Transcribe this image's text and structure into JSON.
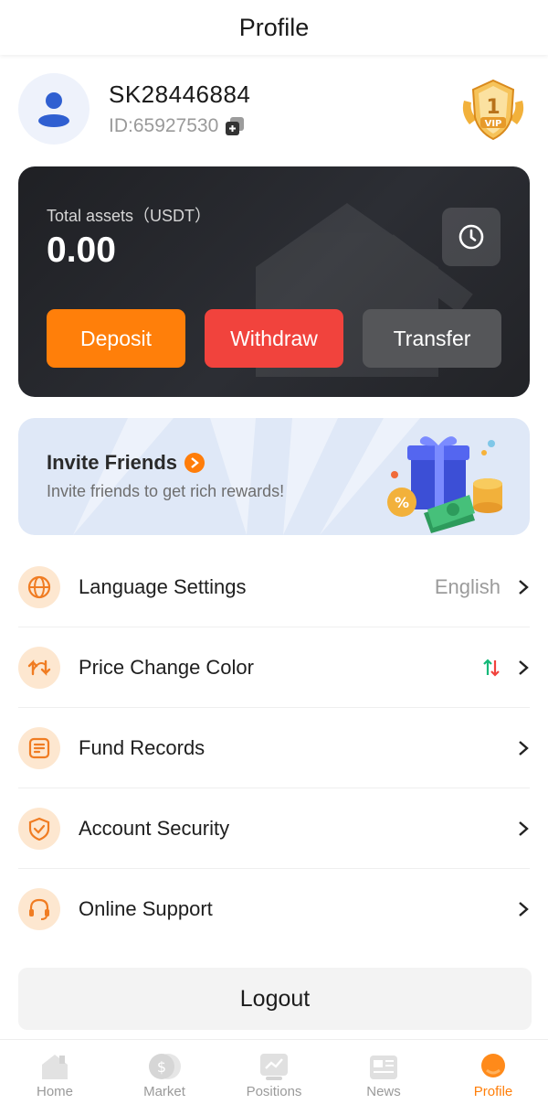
{
  "header": {
    "title": "Profile"
  },
  "user": {
    "username": "SK28446884",
    "id_text": "ID:65927530",
    "vip_level": "1",
    "vip_label": "VIP"
  },
  "assets": {
    "label": "Total assets（USDT）",
    "value": "0.00",
    "buttons": {
      "deposit": "Deposit",
      "withdraw": "Withdraw",
      "transfer": "Transfer"
    }
  },
  "invite": {
    "title": "Invite Friends",
    "subtitle": "Invite friends to get rich rewards!"
  },
  "menu": {
    "items": [
      {
        "label": "Language Settings",
        "value": "English",
        "icon": "globe-icon"
      },
      {
        "label": "Price Change Color",
        "value": "",
        "icon": "swap-icon"
      },
      {
        "label": "Fund Records",
        "value": "",
        "icon": "document-icon"
      },
      {
        "label": "Account Security",
        "value": "",
        "icon": "shield-icon"
      },
      {
        "label": "Online Support",
        "value": "",
        "icon": "headset-icon"
      }
    ]
  },
  "logout": {
    "label": "Logout"
  },
  "tabbar": {
    "items": [
      {
        "label": "Home",
        "icon": "home-icon"
      },
      {
        "label": "Market",
        "icon": "market-icon"
      },
      {
        "label": "Positions",
        "icon": "positions-icon"
      },
      {
        "label": "News",
        "icon": "news-icon"
      },
      {
        "label": "Profile",
        "icon": "profile-icon"
      }
    ],
    "active": "Profile"
  },
  "colors": {
    "accent": "#ff7f0a",
    "withdraw": "#f1433d",
    "transfer": "#555659",
    "card": "#26272b",
    "up": "#16b979",
    "down": "#f1433d"
  }
}
